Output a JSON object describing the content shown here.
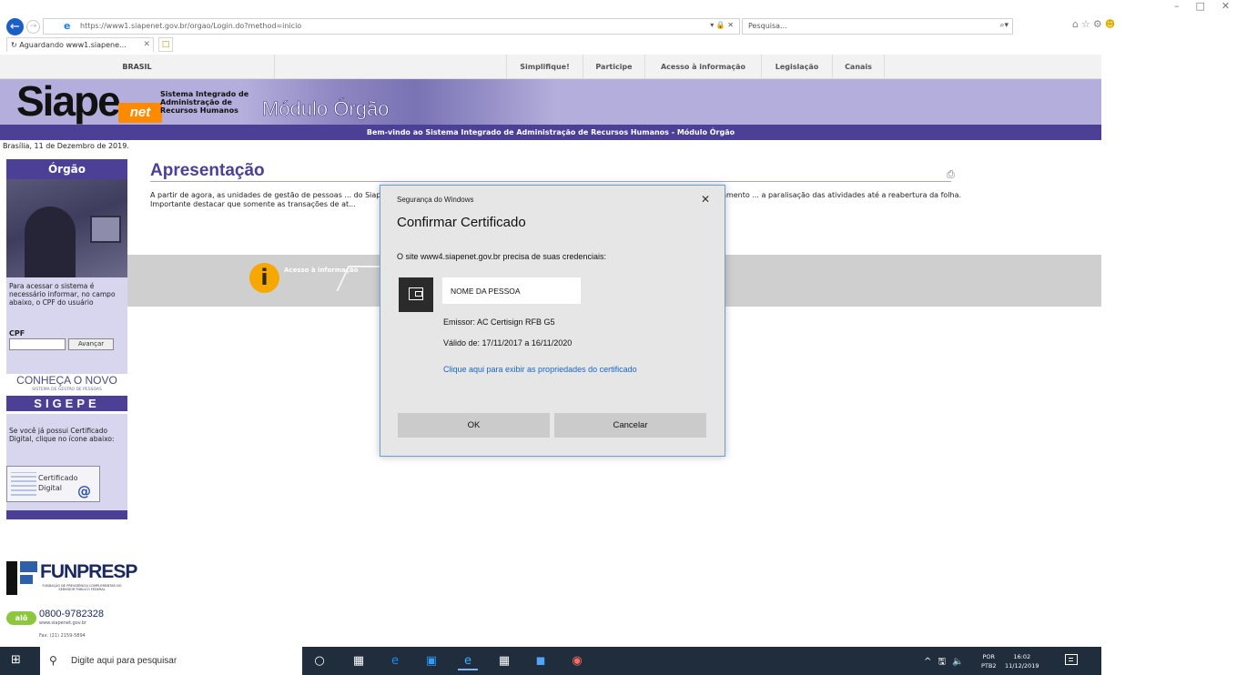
{
  "browser": {
    "url": "https://www1.siapenet.gov.br/orgao/Login.do?method=inicio",
    "url_controls": "▾ 🔒 ✕",
    "search_placeholder": "Pesquisa...",
    "search_button": "⌕▾",
    "tab_title": "Aguardando www1.siapene...",
    "tab_close": "✕",
    "icons": [
      "home-icon",
      "favorites-icon",
      "settings-icon",
      "feedback-smiley-icon"
    ]
  },
  "gov_bar": {
    "brasil": "BRASIL",
    "links": [
      "Simplifique!",
      "Participe",
      "Acesso à informação",
      "Legislação",
      "Canais"
    ]
  },
  "header": {
    "logo_main": "Siape",
    "logo_suffix": "net",
    "logo_desc": "Sistema Integrado de Administração de Recursos Humanos",
    "module": "Módulo Órgão",
    "welcome": "Bem-vindo ao Sistema Integrado de Administração de Recursos Humanos - Módulo Órgão",
    "date": "Brasília, 11 de Dezembro de 2019."
  },
  "sidebar": {
    "title": "Órgão",
    "instruction": "Para acessar o sistema é necessário informar, no campo abaixo, o CPF do usuário",
    "cpf_label": "CPF",
    "cpf_value": "",
    "advance_label": "Avançar",
    "sigepe_title": "CONHEÇA O NOVO",
    "sigepe_sub": "SISTEMA DE GESTÃO DE PESSOAS",
    "sigepe_name": "SIGEPE",
    "cert_instruction": "Se você já possui Certificado Digital, clique no ícone abaixo:",
    "cert_button": "Certificado Digital"
  },
  "funpresp": {
    "name": "FUNPRESP",
    "sub": "FUNDAÇÃO DE PREVIDÊNCIA COMPLEMENTAR DO SERVIDOR PÚBLICO FEDERAL",
    "alo": "alô",
    "phone": "0800-9782328",
    "line1": "www.siapenet.gov.br",
    "line2": "Fax: (21) 2159-5894"
  },
  "main": {
    "title": "Apresentação",
    "intro": "A partir de agora, as unidades de gestão de pessoas ... do Siape poderão consultar o sistema durante todo o processamento da folha. O Ministério do Planejamento ... a paralisação das atividades até a reabertura da folha. Importante destacar que somente as transações de at...",
    "info_label": "Acesso à informação",
    "info_letter": "i"
  },
  "dialog": {
    "caption": "Segurança do Windows",
    "close": "✕",
    "title": "Confirmar Certificado",
    "message": "O site www4.siapenet.gov.br precisa de suas credenciais:",
    "cert_name": "NOME DA PESSOA",
    "issuer": "Emissor: AC Certisign RFB G5",
    "validity": "Válido de: 17/11/2017 a 16/11/2020",
    "properties_link": "Clique aqui para exibir as propriedades do certificado",
    "ok": "OK",
    "cancel": "Cancelar"
  },
  "taskbar": {
    "search_placeholder": "Digite aqui para pesquisar",
    "tray": "^ 🖫 🔈",
    "lang_top": "POR",
    "lang_bottom": "PTB2",
    "time": "16:02",
    "date": "11/12/2019"
  }
}
